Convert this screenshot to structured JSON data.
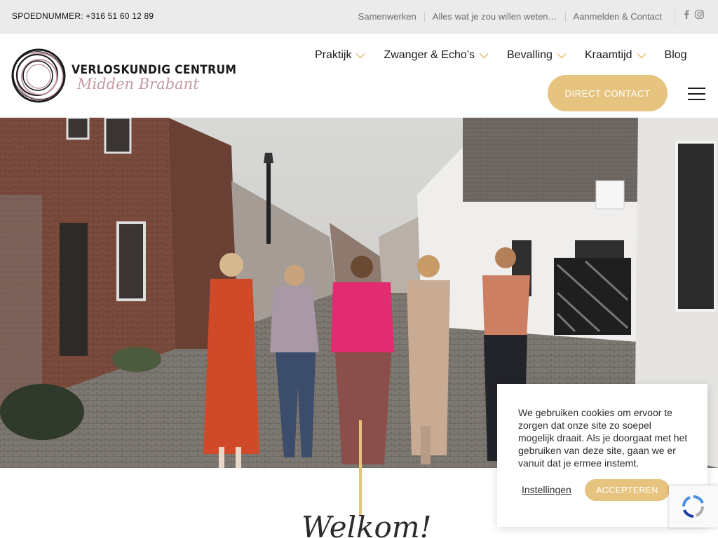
{
  "topbar": {
    "emergency": "SPOEDNUMMER: +316 51 60 12 89",
    "links": [
      "Samenwerken",
      "Alles wat je zou willen weten…",
      "Aanmelden & Contact"
    ],
    "social_icons": [
      "facebook-icon",
      "instagram-icon"
    ]
  },
  "logo": {
    "line1": "VERLOSKUNDIG CENTRUM",
    "line2": "Midden Brabant"
  },
  "nav": {
    "items": [
      {
        "label": "Praktijk",
        "dropdown": true
      },
      {
        "label": "Zwanger & Echo’s",
        "dropdown": true
      },
      {
        "label": "Bevalling",
        "dropdown": true
      },
      {
        "label": "Kraamtijd",
        "dropdown": true
      },
      {
        "label": "Blog",
        "dropdown": false
      }
    ],
    "cta": "DIRECT CONTACT",
    "menu_icon": "hamburger-icon"
  },
  "hero": {
    "heading": "Welkom!"
  },
  "cookie": {
    "message": "We gebruiken cookies om ervoor te zorgen dat onze site zo soepel mogelijk draait. Als je doorgaat met het gebruiken van deze site, gaan we er vanuit dat je ermee instemt.",
    "settings_label": "Instellingen",
    "accept_label": "ACCEPTEREN"
  },
  "colors": {
    "accent": "#e6c47f",
    "logo_pink": "#c39aa2",
    "topbar_bg": "#ebebeb"
  }
}
